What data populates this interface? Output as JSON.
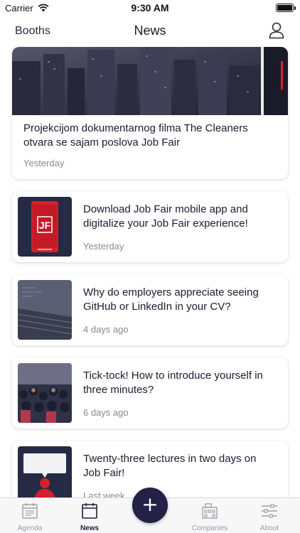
{
  "status_bar": {
    "carrier": "Carrier",
    "time": "9:30 AM"
  },
  "nav": {
    "left_label": "Booths",
    "title": "News",
    "profile_icon": "person-icon"
  },
  "feed": {
    "hero": {
      "title": "Projekcijom dokumentarnog filma The Cleaners otvara se sajam poslova Job Fair",
      "time": "Yesterday"
    },
    "items": [
      {
        "title": "Download Job Fair mobile app and digitalize your Job Fair experience!",
        "time": "Yesterday",
        "thumb": "phone-app-image"
      },
      {
        "title": "Why do employers appreciate seeing GitHub or LinkedIn in your CV?",
        "time": "4 days ago",
        "thumb": "laptop-keyboard-image"
      },
      {
        "title": "Tick-tock! How to introduce yourself in three minutes?",
        "time": "6 days ago",
        "thumb": "audience-image"
      },
      {
        "title": "Twenty-three lectures in two days on Job Fair!",
        "time": "Last week",
        "thumb": "speaker-image"
      }
    ]
  },
  "tabs": [
    {
      "label": "Agenda",
      "icon": "agenda-icon",
      "active": false
    },
    {
      "label": "News",
      "icon": "calendar-icon",
      "active": true
    },
    {
      "label": "Companies",
      "icon": "building-icon",
      "active": false
    },
    {
      "label": "About",
      "icon": "sliders-icon",
      "active": false
    }
  ],
  "fab": {
    "label": "+",
    "icon": "plus-icon"
  },
  "colors": {
    "accent": "#232148",
    "brand_red": "#d4202c",
    "muted_text": "#8a8a8a"
  }
}
